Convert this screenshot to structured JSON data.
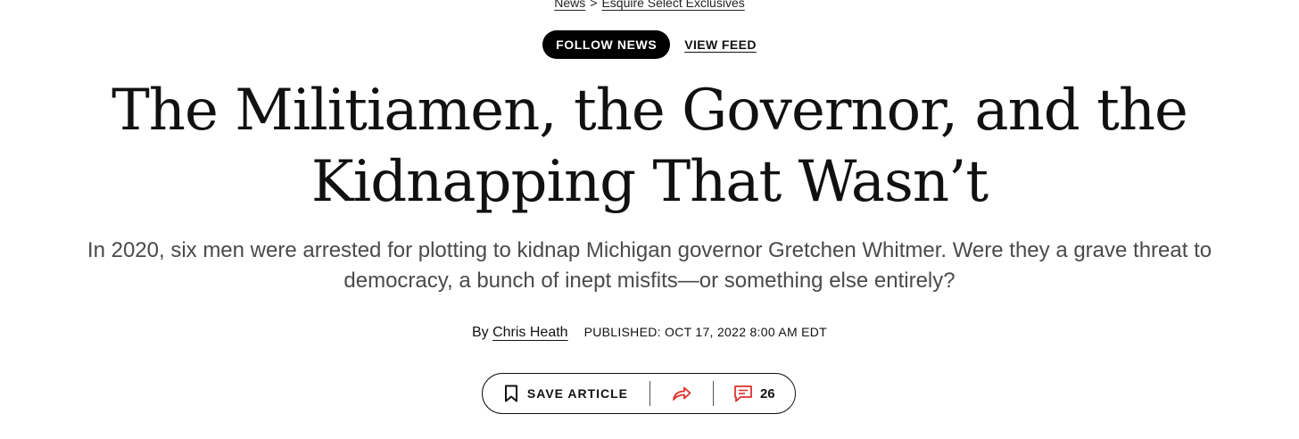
{
  "breadcrumb": {
    "section": "News",
    "separator": ">",
    "subsection": "Esquire Select Exclusives"
  },
  "follow": {
    "follow_label": "FOLLOW NEWS",
    "view_feed_label": "VIEW FEED"
  },
  "article": {
    "headline_line1": "The Militiamen, the Governor, and the",
    "headline_line2": "Kidnapping That Wasn’t",
    "dek_line1": "In 2020, six men were arrested for plotting to kidnap Michigan governor Gretchen Whitmer. Were they a grave threat to",
    "dek_line2": "democracy, a bunch of inept misfits—or something else entirely?",
    "by_prefix": "By",
    "author": "Chris Heath",
    "published": "PUBLISHED: OCT 17, 2022 8:00 AM EDT"
  },
  "actions": {
    "save_label": "SAVE ARTICLE",
    "comment_count": "26",
    "icons": [
      "bookmark-icon",
      "share-icon",
      "comment-icon"
    ]
  },
  "colors": {
    "accent": "#e0312b",
    "text": "#111111",
    "dek": "#4a4a4a"
  }
}
